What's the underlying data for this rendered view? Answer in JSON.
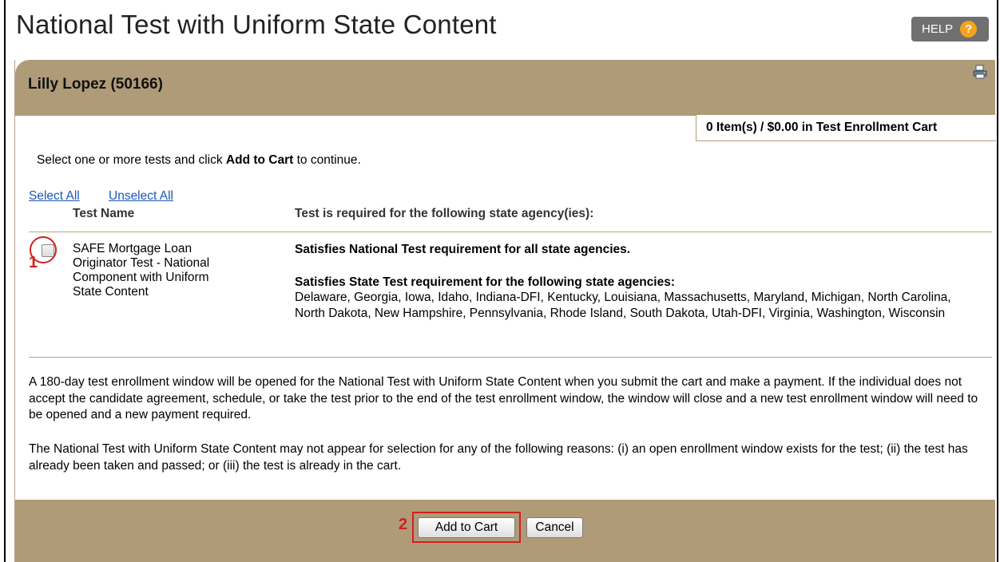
{
  "page": {
    "title": "National Test with Uniform State Content",
    "help_label": "HELP",
    "help_icon_glyph": "?"
  },
  "panel": {
    "person_name": "Lilly Lopez (50166)",
    "cart_summary": "0 Item(s) / $0.00 in Test Enrollment Cart",
    "instruction_pre": "Select one or more tests and click ",
    "instruction_bold": "Add to Cart",
    "instruction_post": " to continue.",
    "select_all": "Select All",
    "unselect_all": "Unselect All",
    "columns": {
      "test_name": "Test Name",
      "required_for": "Test is required for the following state agency(ies):"
    },
    "test_row": {
      "checked": false,
      "name_lines": [
        "SAFE Mortgage Loan",
        "Originator Test - National",
        "Component with Uniform",
        "State Content"
      ],
      "national_requirement": "Satisfies National Test requirement for all state agencies.",
      "state_requirement_title": "Satisfies State Test requirement for the following state agencies:",
      "state_agencies": "Delaware, Georgia, Iowa, Idaho, Indiana-DFI, Kentucky, Louisiana, Massachusetts, Maryland, Michigan, North Carolina, North Dakota, New Hampshire, Pennsylvania, Rhode Island, South Dakota, Utah-DFI, Virginia, Washington, Wisconsin"
    },
    "notes": [
      "A 180-day test enrollment window will be opened for the National Test with Uniform State Content when you submit the cart and make a payment. If the individual does not accept the candidate agreement, schedule, or take the test prior to the end of the test enrollment window, the window will close and a new test enrollment window will need to be opened and a new payment required.",
      "The National Test with Uniform State Content may not appear for selection for any of the following reasons: (i) an open enrollment window exists for the test; (ii) the test has already been taken and passed; or (iii) the test is already in the cart."
    ],
    "buttons": {
      "add_to_cart": "Add to Cart",
      "cancel": "Cancel"
    }
  },
  "annotations": {
    "step_1": "1",
    "step_2": "2",
    "callout_color": "#d21f1f"
  },
  "colors": {
    "panel_tan": "#b09b78",
    "link_blue": "#1a57b8",
    "help_orange": "#f7a21b"
  },
  "icons": {
    "print": "printer-icon",
    "help": "help-icon"
  }
}
